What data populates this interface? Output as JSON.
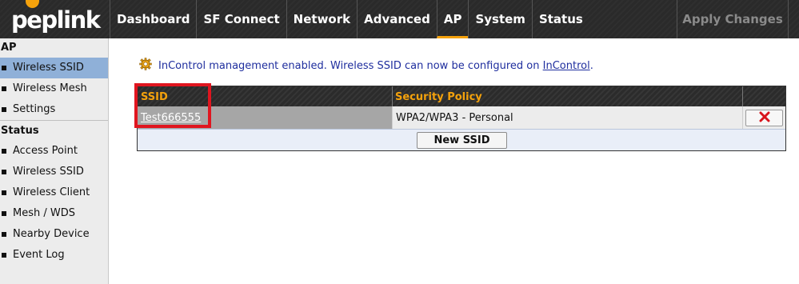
{
  "brand": {
    "logo_text": "peplink",
    "accent": "#f5a20c"
  },
  "nav": {
    "items": [
      {
        "label": "Dashboard",
        "active": false
      },
      {
        "label": "SF Connect",
        "active": false
      },
      {
        "label": "Network",
        "active": false
      },
      {
        "label": "Advanced",
        "active": false
      },
      {
        "label": "AP",
        "active": true
      },
      {
        "label": "System",
        "active": false
      },
      {
        "label": "Status",
        "active": false
      }
    ],
    "apply_label": "Apply Changes"
  },
  "sidebar": {
    "ap_section": "AP",
    "ap_items": [
      {
        "label": "Wireless SSID",
        "active": true
      },
      {
        "label": "Wireless Mesh",
        "active": false
      },
      {
        "label": "Settings",
        "active": false
      }
    ],
    "status_section": "Status",
    "status_items": [
      {
        "label": "Access Point"
      },
      {
        "label": "Wireless SSID"
      },
      {
        "label": "Wireless Client"
      },
      {
        "label": "Mesh / WDS"
      },
      {
        "label": "Nearby Device"
      },
      {
        "label": "Event Log"
      }
    ]
  },
  "notice": {
    "text": "InControl management enabled. Wireless SSID can now be configured on",
    "link": "InControl",
    "suffix": ".",
    "icon": "gear-icon"
  },
  "ssid_table": {
    "headers": {
      "ssid": "SSID",
      "security": "Security Policy"
    },
    "rows": [
      {
        "ssid": "Test666555",
        "security": "WPA2/WPA3 - Personal",
        "delete_icon": "close-icon"
      }
    ],
    "new_button": "New SSID"
  }
}
